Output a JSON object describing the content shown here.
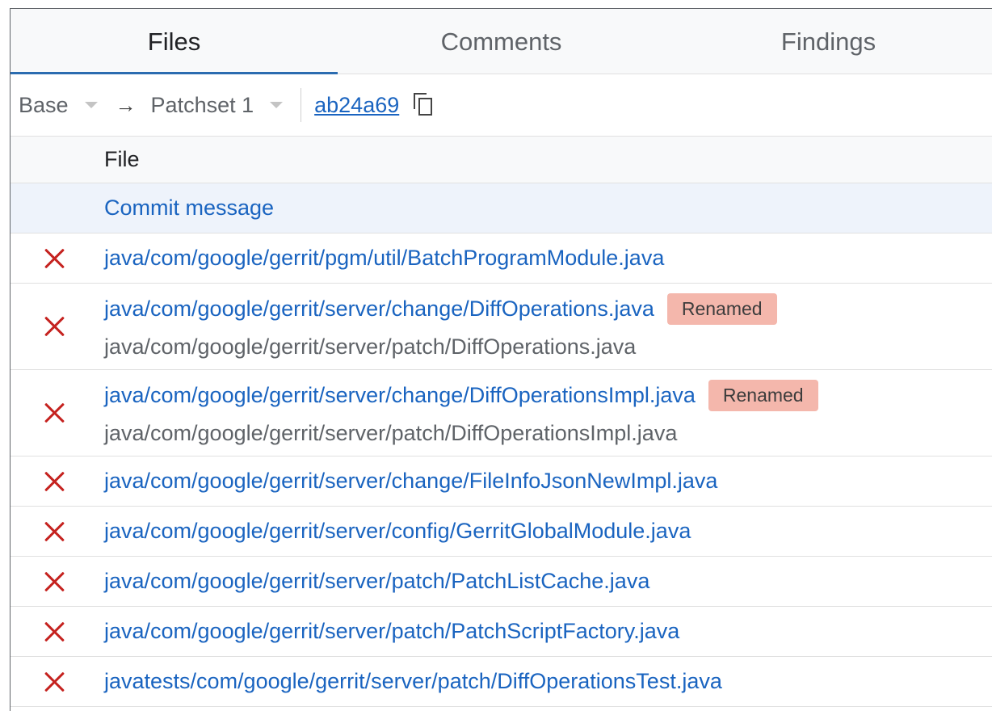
{
  "tabs": [
    {
      "label": "Files",
      "active": true
    },
    {
      "label": "Comments",
      "active": false
    },
    {
      "label": "Findings",
      "active": false
    }
  ],
  "patchset_bar": {
    "base_label": "Base",
    "arrow": "→",
    "target_label": "Patchset 1",
    "commit_sha": "ab24a69",
    "copy_icon": "copy-icon"
  },
  "table": {
    "header": "File",
    "commit_message": "Commit message",
    "files": [
      {
        "status_icon": "deleted-x-icon",
        "path": "java/com/google/gerrit/pgm/util/BatchProgramModule.java"
      },
      {
        "status_icon": "deleted-x-icon",
        "path": "java/com/google/gerrit/server/change/DiffOperations.java",
        "badge": "Renamed",
        "old_path": "java/com/google/gerrit/server/patch/DiffOperations.java"
      },
      {
        "status_icon": "deleted-x-icon",
        "path": "java/com/google/gerrit/server/change/DiffOperationsImpl.java",
        "badge": "Renamed",
        "old_path": "java/com/google/gerrit/server/patch/DiffOperationsImpl.java"
      },
      {
        "status_icon": "deleted-x-icon",
        "path": "java/com/google/gerrit/server/change/FileInfoJsonNewImpl.java"
      },
      {
        "status_icon": "deleted-x-icon",
        "path": "java/com/google/gerrit/server/config/GerritGlobalModule.java"
      },
      {
        "status_icon": "deleted-x-icon",
        "path": "java/com/google/gerrit/server/patch/PatchListCache.java"
      },
      {
        "status_icon": "deleted-x-icon",
        "path": "java/com/google/gerrit/server/patch/PatchScriptFactory.java"
      },
      {
        "status_icon": "deleted-x-icon",
        "path": "javatests/com/google/gerrit/server/patch/DiffOperationsTest.java"
      }
    ]
  },
  "colors": {
    "link": "#1a64c0",
    "deleted_icon": "#c5221f",
    "renamed_badge": "#f4b7ac",
    "tab_indicator": "#2b6cb0"
  }
}
